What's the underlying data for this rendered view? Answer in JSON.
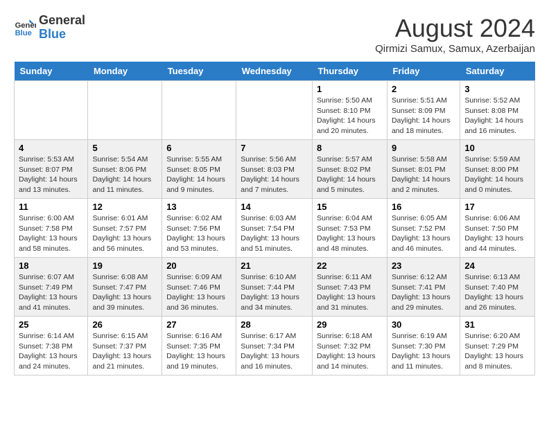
{
  "header": {
    "logo_line1": "General",
    "logo_line2": "Blue",
    "month_year": "August 2024",
    "location": "Qirmizi Samux, Samux, Azerbaijan"
  },
  "weekdays": [
    "Sunday",
    "Monday",
    "Tuesday",
    "Wednesday",
    "Thursday",
    "Friday",
    "Saturday"
  ],
  "weeks": [
    [
      {
        "day": "",
        "info": ""
      },
      {
        "day": "",
        "info": ""
      },
      {
        "day": "",
        "info": ""
      },
      {
        "day": "",
        "info": ""
      },
      {
        "day": "1",
        "info": "Sunrise: 5:50 AM\nSunset: 8:10 PM\nDaylight: 14 hours and 20 minutes."
      },
      {
        "day": "2",
        "info": "Sunrise: 5:51 AM\nSunset: 8:09 PM\nDaylight: 14 hours and 18 minutes."
      },
      {
        "day": "3",
        "info": "Sunrise: 5:52 AM\nSunset: 8:08 PM\nDaylight: 14 hours and 16 minutes."
      }
    ],
    [
      {
        "day": "4",
        "info": "Sunrise: 5:53 AM\nSunset: 8:07 PM\nDaylight: 14 hours and 13 minutes."
      },
      {
        "day": "5",
        "info": "Sunrise: 5:54 AM\nSunset: 8:06 PM\nDaylight: 14 hours and 11 minutes."
      },
      {
        "day": "6",
        "info": "Sunrise: 5:55 AM\nSunset: 8:05 PM\nDaylight: 14 hours and 9 minutes."
      },
      {
        "day": "7",
        "info": "Sunrise: 5:56 AM\nSunset: 8:03 PM\nDaylight: 14 hours and 7 minutes."
      },
      {
        "day": "8",
        "info": "Sunrise: 5:57 AM\nSunset: 8:02 PM\nDaylight: 14 hours and 5 minutes."
      },
      {
        "day": "9",
        "info": "Sunrise: 5:58 AM\nSunset: 8:01 PM\nDaylight: 14 hours and 2 minutes."
      },
      {
        "day": "10",
        "info": "Sunrise: 5:59 AM\nSunset: 8:00 PM\nDaylight: 14 hours and 0 minutes."
      }
    ],
    [
      {
        "day": "11",
        "info": "Sunrise: 6:00 AM\nSunset: 7:58 PM\nDaylight: 13 hours and 58 minutes."
      },
      {
        "day": "12",
        "info": "Sunrise: 6:01 AM\nSunset: 7:57 PM\nDaylight: 13 hours and 56 minutes."
      },
      {
        "day": "13",
        "info": "Sunrise: 6:02 AM\nSunset: 7:56 PM\nDaylight: 13 hours and 53 minutes."
      },
      {
        "day": "14",
        "info": "Sunrise: 6:03 AM\nSunset: 7:54 PM\nDaylight: 13 hours and 51 minutes."
      },
      {
        "day": "15",
        "info": "Sunrise: 6:04 AM\nSunset: 7:53 PM\nDaylight: 13 hours and 48 minutes."
      },
      {
        "day": "16",
        "info": "Sunrise: 6:05 AM\nSunset: 7:52 PM\nDaylight: 13 hours and 46 minutes."
      },
      {
        "day": "17",
        "info": "Sunrise: 6:06 AM\nSunset: 7:50 PM\nDaylight: 13 hours and 44 minutes."
      }
    ],
    [
      {
        "day": "18",
        "info": "Sunrise: 6:07 AM\nSunset: 7:49 PM\nDaylight: 13 hours and 41 minutes."
      },
      {
        "day": "19",
        "info": "Sunrise: 6:08 AM\nSunset: 7:47 PM\nDaylight: 13 hours and 39 minutes."
      },
      {
        "day": "20",
        "info": "Sunrise: 6:09 AM\nSunset: 7:46 PM\nDaylight: 13 hours and 36 minutes."
      },
      {
        "day": "21",
        "info": "Sunrise: 6:10 AM\nSunset: 7:44 PM\nDaylight: 13 hours and 34 minutes."
      },
      {
        "day": "22",
        "info": "Sunrise: 6:11 AM\nSunset: 7:43 PM\nDaylight: 13 hours and 31 minutes."
      },
      {
        "day": "23",
        "info": "Sunrise: 6:12 AM\nSunset: 7:41 PM\nDaylight: 13 hours and 29 minutes."
      },
      {
        "day": "24",
        "info": "Sunrise: 6:13 AM\nSunset: 7:40 PM\nDaylight: 13 hours and 26 minutes."
      }
    ],
    [
      {
        "day": "25",
        "info": "Sunrise: 6:14 AM\nSunset: 7:38 PM\nDaylight: 13 hours and 24 minutes."
      },
      {
        "day": "26",
        "info": "Sunrise: 6:15 AM\nSunset: 7:37 PM\nDaylight: 13 hours and 21 minutes."
      },
      {
        "day": "27",
        "info": "Sunrise: 6:16 AM\nSunset: 7:35 PM\nDaylight: 13 hours and 19 minutes."
      },
      {
        "day": "28",
        "info": "Sunrise: 6:17 AM\nSunset: 7:34 PM\nDaylight: 13 hours and 16 minutes."
      },
      {
        "day": "29",
        "info": "Sunrise: 6:18 AM\nSunset: 7:32 PM\nDaylight: 13 hours and 14 minutes."
      },
      {
        "day": "30",
        "info": "Sunrise: 6:19 AM\nSunset: 7:30 PM\nDaylight: 13 hours and 11 minutes."
      },
      {
        "day": "31",
        "info": "Sunrise: 6:20 AM\nSunset: 7:29 PM\nDaylight: 13 hours and 8 minutes."
      }
    ]
  ]
}
